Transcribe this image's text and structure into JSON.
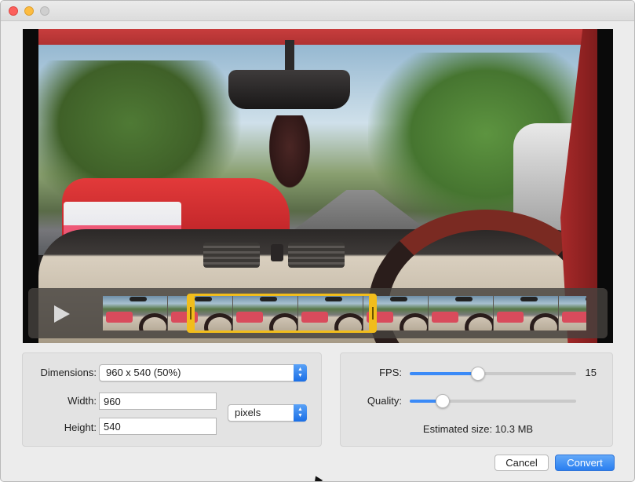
{
  "window": {
    "controls": [
      "close",
      "minimize",
      "zoom"
    ]
  },
  "player": {
    "play_icon": "play-icon",
    "thumbnail_count": 8,
    "trim_start_fraction": 0.19,
    "trim_end_fraction": 0.55
  },
  "size": {
    "dimensions_label": "Dimensions:",
    "dimensions_value": "960 x 540 (50%)",
    "width_label": "Width:",
    "width_value": "960",
    "height_label": "Height:",
    "height_value": "540",
    "unit_value": "pixels"
  },
  "output": {
    "fps_label": "FPS:",
    "fps_value": "15",
    "fps_fraction": 0.41,
    "quality_label": "Quality:",
    "quality_fraction": 0.2,
    "estimated_size": "Estimated size: 10.3 MB"
  },
  "buttons": {
    "cancel": "Cancel",
    "convert": "Convert"
  },
  "colors": {
    "accent": "#2a7ff0",
    "trim_handle": "#f1bd1c"
  }
}
